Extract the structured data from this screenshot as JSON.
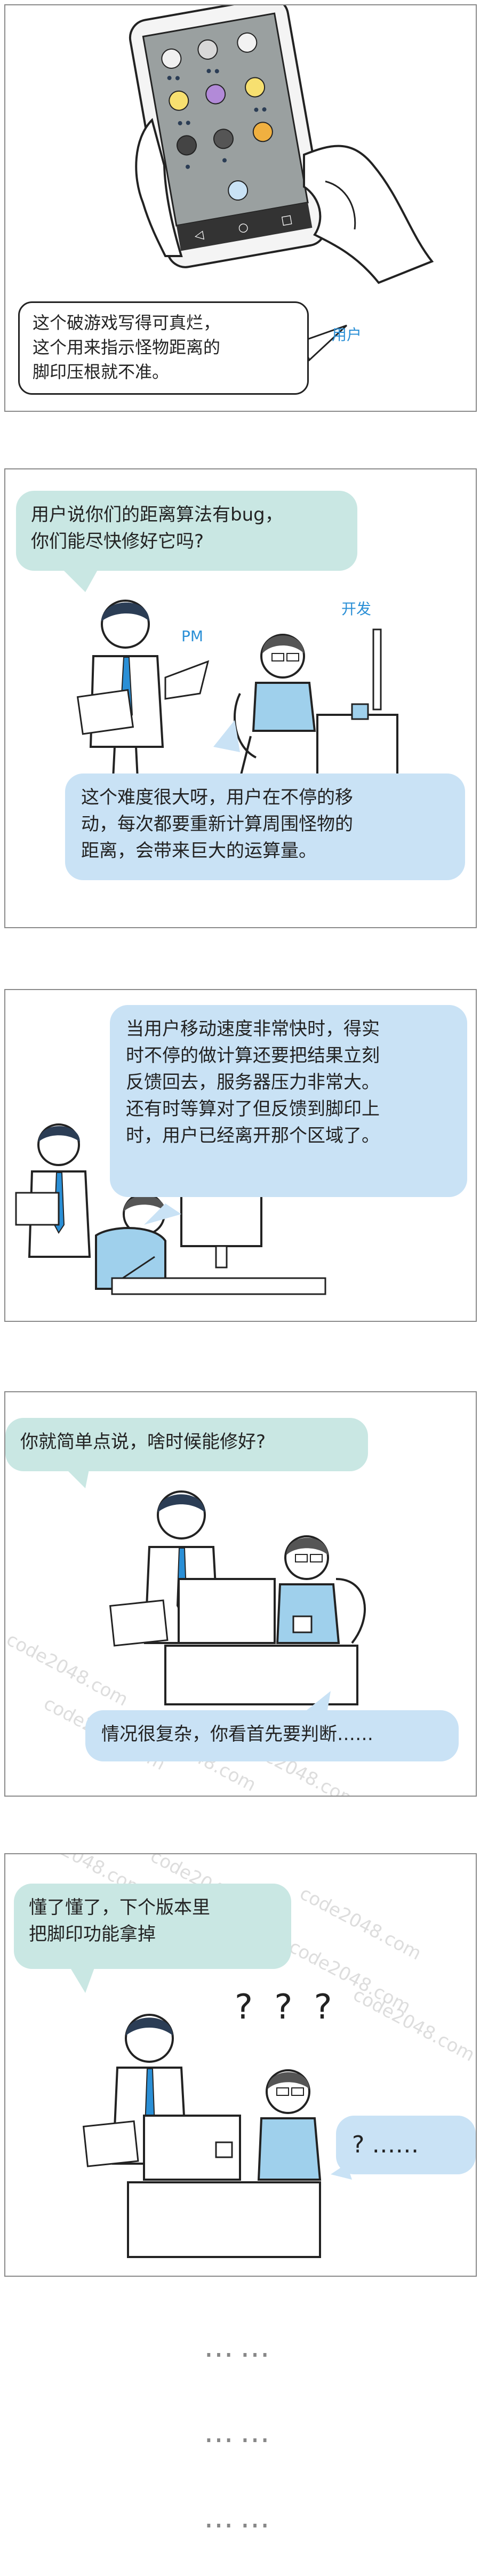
{
  "panels": {
    "p1": {
      "speech": [
        "这个破游戏写得可真烂，",
        "这个用来指示怪物距离的",
        "脚印压根就不准。"
      ],
      "label": "用户"
    },
    "p2": {
      "speech_top": [
        "用户说你们的距离算法有bug，",
        "你们能尽快修好它吗?"
      ],
      "label_pm": "PM",
      "label_dev": "开发",
      "speech_bottom": [
        "这个难度很大呀，用户在不停的移",
        "动，每次都要重新计算周围怪物的",
        "距离，会带来巨大的运算量。"
      ]
    },
    "p3": {
      "speech": [
        "当用户移动速度非常快时，得实",
        "时不停的做计算还要把结果立刻",
        "反馈回去，服务器压力非常大。",
        "还有时等算对了但反馈到脚印上",
        "时，用户已经离开那个区域了。"
      ]
    },
    "p4": {
      "speech_top": "你就简单点说，啥时候能修好?",
      "speech_bottom": "情况很复杂，你看首先要判断……",
      "watermark": "code2048.com"
    },
    "p5": {
      "speech_top": [
        "懂了懂了，下个版本里",
        "把脚印功能拿掉"
      ],
      "question_marks": "? ? ?",
      "speech_right": "? ……",
      "watermark": "code2048.com"
    }
  },
  "footer_dots": [
    "……",
    "……",
    "……"
  ]
}
